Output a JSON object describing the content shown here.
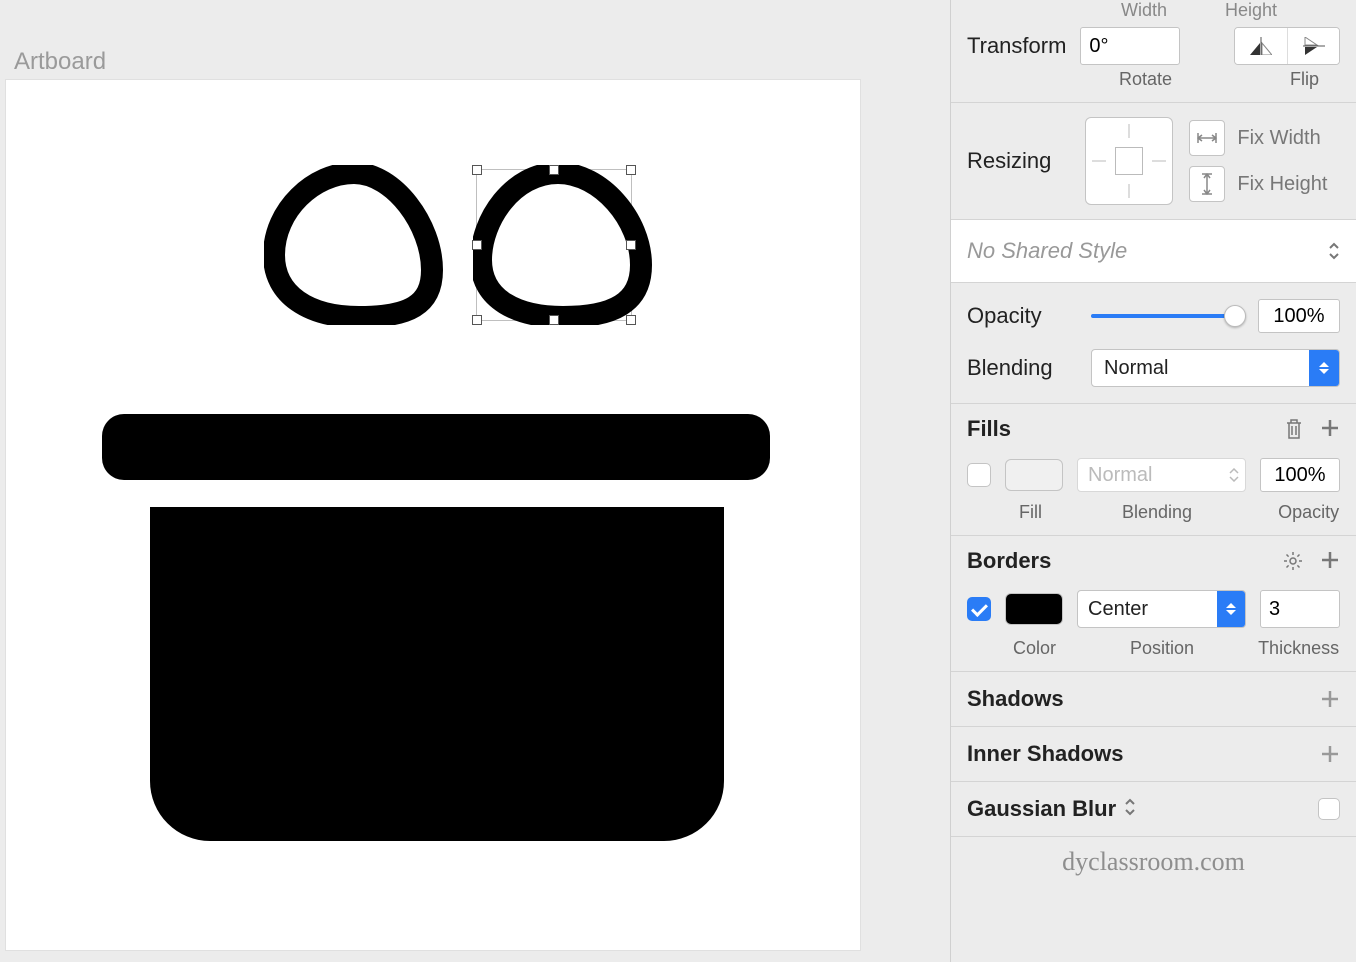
{
  "canvas": {
    "artboard_label": "Artboard"
  },
  "inspector": {
    "top_labels": {
      "width": "Width",
      "height": "Height"
    },
    "transform": {
      "label": "Transform",
      "rotate_value": "0°",
      "rotate_sublabel": "Rotate",
      "flip_sublabel": "Flip"
    },
    "resizing": {
      "label": "Resizing",
      "fix_width": "Fix Width",
      "fix_height": "Fix Height"
    },
    "shared_style": {
      "text": "No Shared Style"
    },
    "opacity": {
      "label": "Opacity",
      "value": "100%",
      "blending_label": "Blending",
      "blending_value": "Normal"
    },
    "fills": {
      "title": "Fills",
      "enabled": false,
      "blend": "Normal",
      "opacity": "100%",
      "sub_fill": "Fill",
      "sub_blend": "Blending",
      "sub_opacity": "Opacity"
    },
    "borders": {
      "title": "Borders",
      "enabled": true,
      "position": "Center",
      "thickness": "3",
      "sub_color": "Color",
      "sub_position": "Position",
      "sub_thickness": "Thickness"
    },
    "shadows": {
      "title": "Shadows"
    },
    "inner_shadows": {
      "title": "Inner Shadows"
    },
    "gaussian_blur": {
      "title": "Gaussian Blur"
    }
  },
  "watermark": "dyclassroom.com"
}
